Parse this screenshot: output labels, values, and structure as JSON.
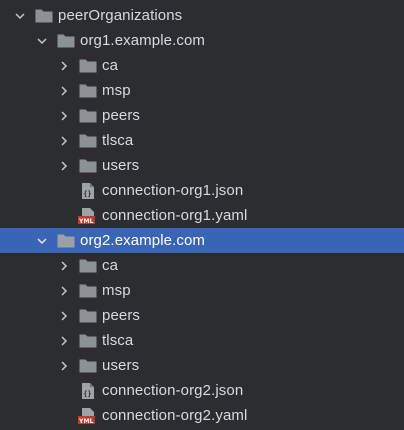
{
  "tree": {
    "root": {
      "label": "peerOrganizations",
      "expanded": true
    },
    "org1": {
      "label": "org1.example.com",
      "expanded": true,
      "folders": [
        "ca",
        "msp",
        "peers",
        "tlsca",
        "users"
      ],
      "files": [
        {
          "label": "connection-org1.json",
          "icon": "json-file-icon"
        },
        {
          "label": "connection-org1.yaml",
          "icon": "yaml-file-icon"
        }
      ]
    },
    "org2": {
      "label": "org2.example.com",
      "expanded": true,
      "selected": true,
      "folders": [
        "ca",
        "msp",
        "peers",
        "tlsca",
        "users"
      ],
      "files": [
        {
          "label": "connection-org2.json",
          "icon": "json-file-icon"
        },
        {
          "label": "connection-org2.yaml",
          "icon": "yaml-file-icon"
        }
      ]
    }
  },
  "colors": {
    "background": "#2b2d30",
    "selection": "#3a64b5",
    "folder": "#8c9196",
    "text": "#d7dae0",
    "yaml_badge": "#c0392b"
  }
}
